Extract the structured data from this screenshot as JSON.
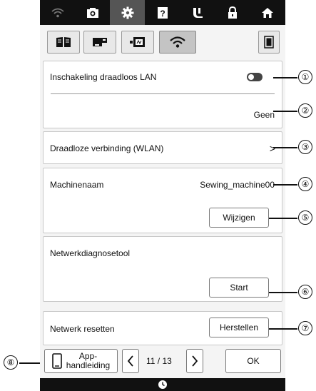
{
  "topbar": {
    "icons": [
      "wifi-icon",
      "camera-icon",
      "settings-gear-icon",
      "help-icon",
      "presser-foot-icon",
      "lock-icon",
      "home-icon"
    ],
    "active_index": 2
  },
  "subtabs": {
    "icons": [
      "book-icon",
      "sewing-machine-icon",
      "embroidery-icon",
      "wifi-icon",
      "screen-icon"
    ],
    "active_index": 3
  },
  "wlan": {
    "label": "Inschakeling draadloos LAN",
    "toggle_state": "off",
    "status_value": "Geen"
  },
  "wireless": {
    "label": "Draadloze verbinding (WLAN)",
    "chevron": ">"
  },
  "machine": {
    "label": "Machinenaam",
    "value": "Sewing_machine00",
    "button": "Wijzigen"
  },
  "diagnose": {
    "label": "Netwerkdiagnosetool",
    "button": "Start"
  },
  "reset": {
    "label": "Netwerk resetten",
    "button": "Herstellen"
  },
  "bottom": {
    "app_line1": "App-",
    "app_line2": "handleiding",
    "prev": "<",
    "page": "11 / 13",
    "next": ">",
    "ok": "OK"
  },
  "callouts": [
    "①",
    "②",
    "③",
    "④",
    "⑤",
    "⑥",
    "⑦",
    "⑧"
  ]
}
